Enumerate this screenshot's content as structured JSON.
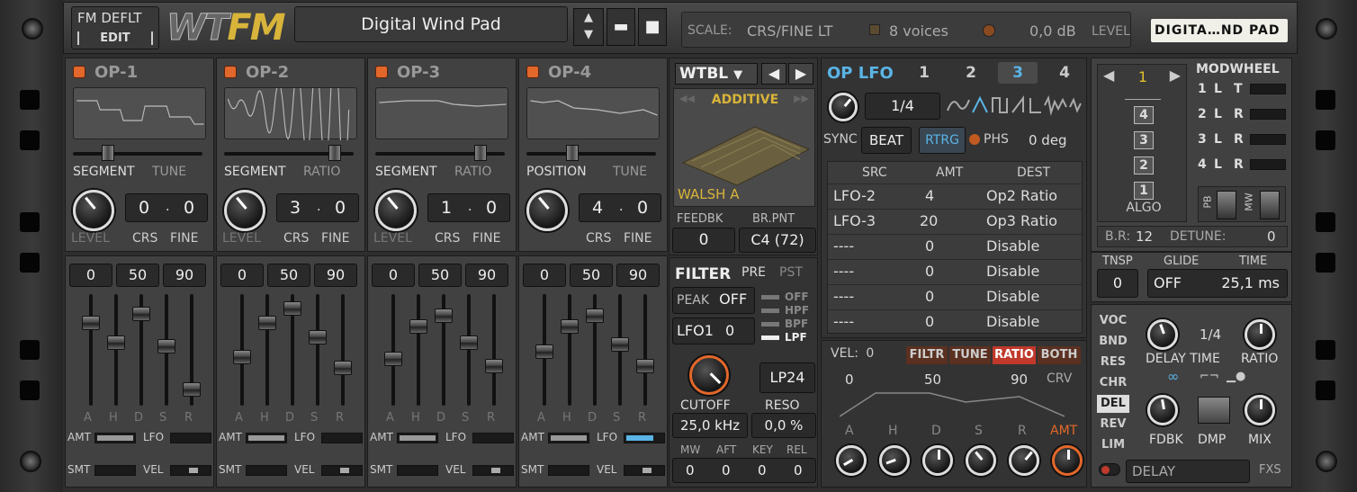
{
  "patch": {
    "name_box": "FM DEFLT",
    "edit": "EDIT",
    "logo_wt": "WT",
    "logo_fm": "FM",
    "preset_name": "Digital Wind Pad"
  },
  "status": {
    "scale_label": "SCALE:",
    "scale_value": "CRS/FINE LT",
    "voices": "8 voices",
    "level_value": "0,0 dB",
    "level_label": "LEVEL",
    "tape_label": "DIGITA…ND PAD"
  },
  "ops": [
    {
      "name": "OP-1",
      "mode_a": "SEGMENT",
      "mode_b": "TUNE",
      "crs": "0",
      "fine": "0",
      "level": "LEVEL",
      "crs_l": "CRS",
      "fine_l": "FINE"
    },
    {
      "name": "OP-2",
      "mode_a": "SEGMENT",
      "mode_b": "RATIO",
      "crs": "3",
      "fine": "0",
      "level": "LEVEL",
      "crs_l": "CRS",
      "fine_l": "FINE"
    },
    {
      "name": "OP-3",
      "mode_a": "SEGMENT",
      "mode_b": "RATIO",
      "crs": "1",
      "fine": "0",
      "level": "LEVEL",
      "crs_l": "CRS",
      "fine_l": "FINE"
    },
    {
      "name": "OP-4",
      "mode_a": "POSITION",
      "mode_b": "TUNE",
      "crs": "4",
      "fine": "0",
      "level": "",
      "crs_l": "CRS",
      "fine_l": "FINE"
    }
  ],
  "env": {
    "v1": "0",
    "v2": "50",
    "v3": "90",
    "labels": [
      "A",
      "H",
      "D",
      "S",
      "R"
    ],
    "amt": "AMT",
    "lfo": "LFO",
    "smt": "SMT",
    "vel": "VEL"
  },
  "wtbl": {
    "title": "WTBL",
    "mode": "ADDITIVE",
    "table": "WALSH A",
    "feedbk_l": "FEEDBK",
    "feedbk": "0",
    "brpnt_l": "BR.PNT",
    "brpnt": "C4 (72)"
  },
  "filter": {
    "title": "FILTER",
    "pre": "PRE",
    "pst": "PST",
    "peak_l": "PEAK",
    "peak": "OFF",
    "types": [
      "OFF",
      "HPF",
      "BPF",
      "LPF"
    ],
    "lfo_l": "LFO1",
    "lfo_v": "0",
    "mode": "LP24",
    "cutoff_l": "CUTOFF",
    "reso_l": "RESO",
    "cutoff": "25,0 kHz",
    "reso": "0,0 %",
    "mw": "MW",
    "aft": "AFT",
    "key": "KEY",
    "rel": "REL",
    "mw_v": "0",
    "aft_v": "0",
    "key_v": "0",
    "rel_v": "0"
  },
  "lfo": {
    "title": "OP LFO",
    "tabs": [
      "1",
      "2",
      "3",
      "4"
    ],
    "rate": "1/4",
    "sync": "SYNC",
    "beat": "BEAT",
    "rtrg": "RTRG",
    "phs": "PHS",
    "phase": "0 deg",
    "cols": [
      "SRC",
      "AMT",
      "DEST"
    ],
    "rows": [
      [
        "LFO-2",
        "4",
        "Op2 Ratio"
      ],
      [
        "LFO-3",
        "20",
        "Op3 Ratio"
      ],
      [
        "----",
        "0",
        "Disable"
      ],
      [
        "----",
        "0",
        "Disable"
      ],
      [
        "----",
        "0",
        "Disable"
      ],
      [
        "----",
        "0",
        "Disable"
      ]
    ],
    "vel_l": "VEL:",
    "vel": "0",
    "targets": [
      "FILTR",
      "TUNE",
      "RATIO",
      "BOTH"
    ],
    "e1": "0",
    "e2": "50",
    "e3": "90",
    "crv": "CRV",
    "adsr": [
      "A",
      "H",
      "D",
      "S",
      "R"
    ],
    "amt": "AMT"
  },
  "algo": {
    "num": "1",
    "boxes": [
      "4",
      "3",
      "2",
      "1"
    ],
    "label": "ALGO",
    "modwheel": "MODWHEEL",
    "mw_rows": [
      [
        "1",
        "L",
        "T"
      ],
      [
        "2",
        "L",
        "R"
      ],
      [
        "3",
        "L",
        "R"
      ],
      [
        "4",
        "L",
        "R"
      ]
    ],
    "pb": "PB",
    "mw": "MW",
    "br_l": "B.R:",
    "br": "12",
    "detune_l": "DETUNE:",
    "detune": "0"
  },
  "glide": {
    "tnsp_l": "TNSP",
    "tnsp": "0",
    "glide_l": "GLIDE",
    "glide": "OFF",
    "time_l": "TIME",
    "time": "25,1 ms"
  },
  "fx": {
    "tabs": [
      "VOC",
      "BND",
      "RES",
      "CHR",
      "DEL",
      "REV",
      "LIM"
    ],
    "sync": "1/4",
    "delay_l": "DELAY",
    "time_l": "TIME",
    "ratio_l": "RATIO",
    "fdbk_l": "FDBK",
    "dmp_l": "DMP",
    "mix_l": "MIX",
    "name": "DELAY",
    "fxs": "FXS"
  },
  "colors": {
    "accent": "#e2672a",
    "blue": "#5ab4e6",
    "ratio_red": "#c0392b",
    "yellow": "#e0c02a"
  }
}
